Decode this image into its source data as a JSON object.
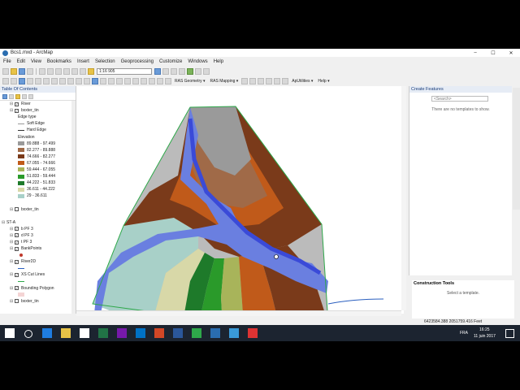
{
  "window": {
    "title": "Bcs1.mxd - ArcMap",
    "minimize": "–",
    "maximize": "☐",
    "close": "✕"
  },
  "menu": [
    "File",
    "Edit",
    "View",
    "Bookmarks",
    "Insert",
    "Selection",
    "Geoprocessing",
    "Customize",
    "Windows",
    "Help"
  ],
  "toolbar": {
    "scale": "1:16 905",
    "ras_geometry": "RAS Geometry ▾",
    "ras_mapping": "RAS Mapping ▾",
    "apputilities": "ApUtilities ▾",
    "help": "Help ▾"
  },
  "toc": {
    "title": "Table Of Contents",
    "items": [
      {
        "kind": "layer",
        "label": "River",
        "checked": true
      },
      {
        "kind": "layer",
        "label": "bxxter_tin",
        "checked": true
      },
      {
        "kind": "text",
        "label": "Edge type"
      },
      {
        "kind": "line",
        "label": "Soft Edge",
        "color": "#999999"
      },
      {
        "kind": "line",
        "label": "Hard Edge",
        "color": "#333333"
      },
      {
        "kind": "text",
        "label": "Elevation"
      },
      {
        "kind": "swatch",
        "label": "89.888 - 97.499",
        "color": "#9a9a9a"
      },
      {
        "kind": "swatch",
        "label": "82.277 - 89.888",
        "color": "#a06a48"
      },
      {
        "kind": "swatch",
        "label": "74.666 - 82.277",
        "color": "#7a3a1a"
      },
      {
        "kind": "swatch",
        "label": "67.055 - 74.666",
        "color": "#c05a1a"
      },
      {
        "kind": "swatch",
        "label": "59.444 - 67.055",
        "color": "#a8b45a"
      },
      {
        "kind": "swatch",
        "label": "51.833 - 59.444",
        "color": "#2a9a2a"
      },
      {
        "kind": "swatch",
        "label": "44.222 - 51.833",
        "color": "#1e7a2a"
      },
      {
        "kind": "swatch",
        "label": "36.611 - 44.222",
        "color": "#d8d8a8"
      },
      {
        "kind": "swatch",
        "label": "29 - 36.611",
        "color": "#a8d0c8"
      },
      {
        "kind": "blank",
        "label": ""
      },
      {
        "kind": "layer",
        "label": "bxxter_tin",
        "checked": false
      },
      {
        "kind": "blank",
        "label": ""
      },
      {
        "kind": "group",
        "label": "ST-A"
      },
      {
        "kind": "layer",
        "label": "b PF 3",
        "checked": true
      },
      {
        "kind": "layer",
        "label": "d PF 3",
        "checked": true
      },
      {
        "kind": "layer",
        "label": "t PF 3",
        "checked": true
      },
      {
        "kind": "layer",
        "label": "BankPoints",
        "checked": true
      },
      {
        "kind": "dot",
        "label": "",
        "color": "#c0392b"
      },
      {
        "kind": "layer",
        "label": "River2D",
        "checked": true
      },
      {
        "kind": "line",
        "label": "",
        "color": "#2a5fbf"
      },
      {
        "kind": "layer",
        "label": "XS Cut Lines",
        "checked": true
      },
      {
        "kind": "line",
        "label": "",
        "color": "#2ea84a"
      },
      {
        "kind": "layer",
        "label": "Bounding Polygon",
        "checked": true
      },
      {
        "kind": "swatch",
        "label": "",
        "color": "#f4d4d4"
      },
      {
        "kind": "layer",
        "label": "bxxter_tin",
        "checked": false
      }
    ]
  },
  "create_features": {
    "title": "Create Features",
    "search_placeholder": "<Search>",
    "empty_msg": "There are no templates to show."
  },
  "construction_tools": {
    "title": "Construction Tools",
    "msg": "Select a template."
  },
  "status": {
    "coords": "6423584.388  2051759.416 Feet"
  },
  "taskbar": {
    "lang": "FRA",
    "time": "16:25",
    "date": "11 juin 2017"
  },
  "colors": {
    "water": "#6a7fe0",
    "dark_water": "#3a4ad8"
  }
}
